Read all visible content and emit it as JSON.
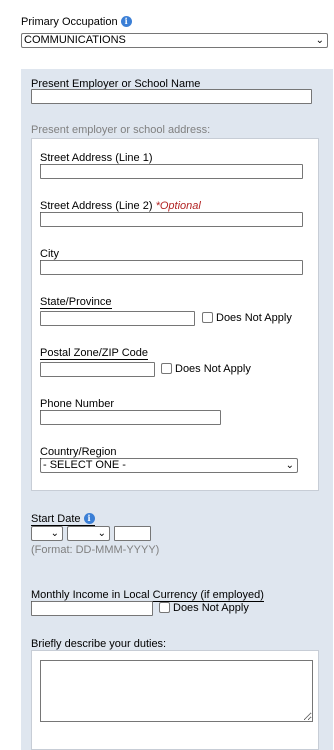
{
  "occupation": {
    "label": "Primary Occupation",
    "value": "COMMUNICATIONS"
  },
  "employer": {
    "label": "Present Employer or School Name"
  },
  "address": {
    "heading": "Present employer or school address:",
    "street1_label": "Street Address (Line 1)",
    "street2_label": "Street Address (Line 2)",
    "street2_optional": "*Optional",
    "city_label": "City",
    "state_label": "State/Province",
    "state_dna": "Does Not Apply",
    "zip_label": "Postal Zone/ZIP Code",
    "zip_dna": "Does Not Apply",
    "phone_label": "Phone Number",
    "country_label": "Country/Region",
    "country_value": "- SELECT ONE -"
  },
  "start_date": {
    "label": "Start Date",
    "format_hint": "(Format: DD-MMM-YYYY)"
  },
  "income": {
    "label": "Monthly Income in Local Currency (if employed)",
    "dna": "Does Not Apply"
  },
  "duties": {
    "label": "Briefly describe your duties:"
  },
  "icons": {
    "info": "info-icon",
    "chevron": "chevron-down-icon"
  },
  "colors": {
    "panel_bg": "#dfe6ef",
    "optional_red": "#b22222",
    "info_blue": "#3b7fd6"
  }
}
